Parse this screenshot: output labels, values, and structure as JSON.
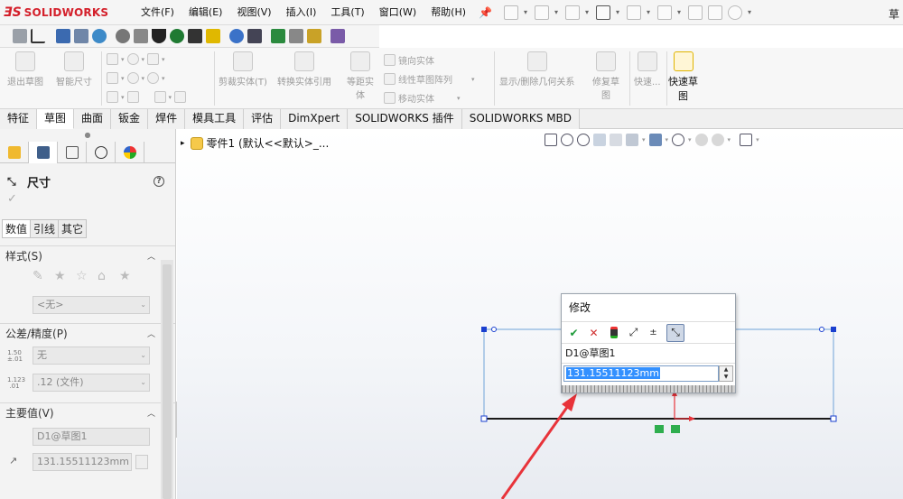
{
  "app": {
    "logo_ds": "ƎS",
    "logo_name": "SOLIDWORKS",
    "window_edge_text": "草"
  },
  "menu": [
    "文件(F)",
    "编辑(E)",
    "视图(V)",
    "插入(I)",
    "工具(T)",
    "窗口(W)",
    "帮助(H)"
  ],
  "commands": {
    "exit_sketch": "退出草图",
    "smart_dimension": "智能尺寸",
    "trim_entities": "剪裁实体(T)",
    "convert_entities": "转换实体引用",
    "offset_entities_line1": "等距实",
    "offset_entities_line2": "体",
    "mirror_entities": "镜向实体",
    "linear_pattern": "线性草图阵列",
    "move_entities": "移动实体",
    "display_relations": "显示/删除几何关系",
    "repair_sketch_line1": "修复草",
    "repair_sketch_line2": "图",
    "quick_snaps": "快速...",
    "rapid_sketch_line1": "快速草",
    "rapid_sketch_line2": "图"
  },
  "tabs": [
    "特征",
    "草图",
    "曲面",
    "钣金",
    "焊件",
    "模具工具",
    "评估",
    "DimXpert",
    "SOLIDWORKS 插件",
    "SOLIDWORKS MBD"
  ],
  "active_tab": "草图",
  "property_manager": {
    "title": "尺寸",
    "help": "?",
    "ok_mark": "✓",
    "subtabs": [
      "数值",
      "引线",
      "其它"
    ],
    "style_section": "样式(S)",
    "style_select": "<无>",
    "tolerance_section": "公差/精度(P)",
    "tolerance_type": "无",
    "precision": ".12 (文件)",
    "primary_section": "主要值(V)",
    "primary_name": "D1@草图1",
    "primary_value": "131.15511123mm",
    "tol_icon_top": "1.50 ±.01",
    "prec_icon_top": "1.123 .01"
  },
  "feature_tree": {
    "root": "零件1 (默认<<默认>_..."
  },
  "modify_dialog": {
    "title": "修改",
    "dimension_name": "D1@草图1",
    "value": "131.15511123mm",
    "spin_up": "▲",
    "spin_down": "▼"
  },
  "colors": {
    "accent": "#d4202b",
    "selection": "#3390ff",
    "sketch_line": "#1a1a1a",
    "construction": "#6fa3d8",
    "arrow": "#e8333a"
  }
}
